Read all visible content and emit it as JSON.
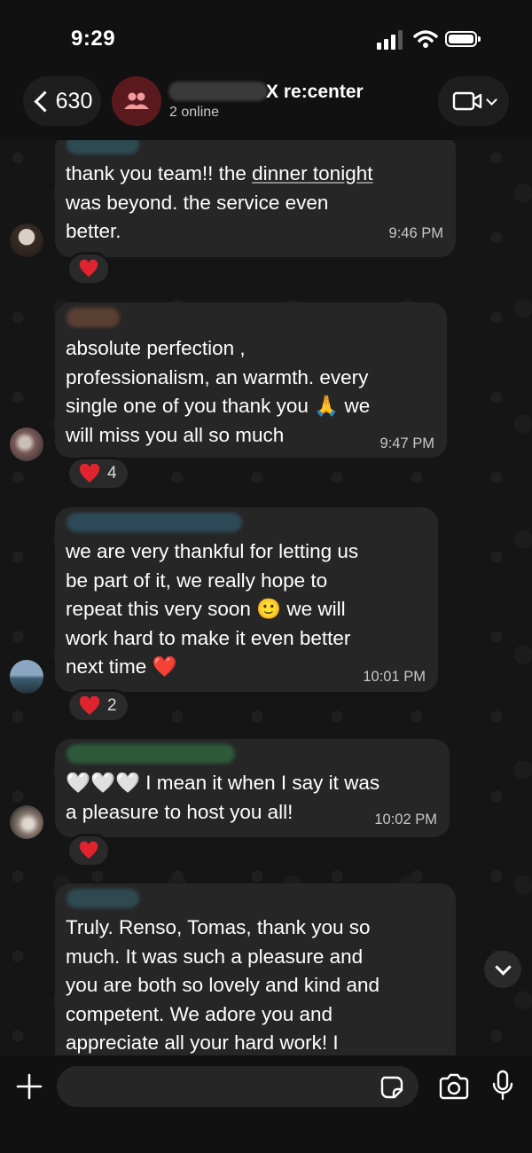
{
  "status_bar": {
    "time": "9:29"
  },
  "header": {
    "back_count": "630",
    "group_name": "X re:center",
    "online": "2 online"
  },
  "messages": [
    {
      "text_before": "thank you team!! the ",
      "text_link": "dinner tonight",
      "text_after": "\nwas beyond. the service even\nbetter.",
      "time": "9:46 PM",
      "reaction_count": ""
    },
    {
      "text": "absolute perfection ,\nprofessionalism, an warmth. every\nsingle one of you thank you 🙏 we\nwill miss you all so much",
      "time": "9:47 PM",
      "reaction_count": "4"
    },
    {
      "text": "we are very thankful for letting us\nbe part of it, we really hope to\nrepeat this very soon 🙂 we will\nwork hard to make it even better\nnext time ❤️",
      "time": "10:01 PM",
      "reaction_count": "2"
    },
    {
      "text": "🤍🤍🤍 I mean it when I say it was\na pleasure to host you all!",
      "time": "10:02 PM",
      "reaction_count": ""
    },
    {
      "text": "Truly. Renso, Tomas, thank you so\nmuch. It was such a pleasure and\nyou are both so lovely and kind and\ncompetent. We adore you and\nappreciate all your hard work! I",
      "time": "",
      "reaction_count": ""
    }
  ],
  "input": {
    "placeholder": ""
  },
  "colors": {
    "heart": "#e0242f",
    "bubble": "#262626",
    "group_avatar": "#5a1a1d"
  },
  "icons": [
    "signal-icon",
    "wifi-icon",
    "battery-icon",
    "back-chevron-icon",
    "group-icon",
    "video-icon",
    "heart-icon",
    "chevron-down-icon",
    "plus-icon",
    "sticker-icon",
    "camera-icon",
    "microphone-icon"
  ]
}
